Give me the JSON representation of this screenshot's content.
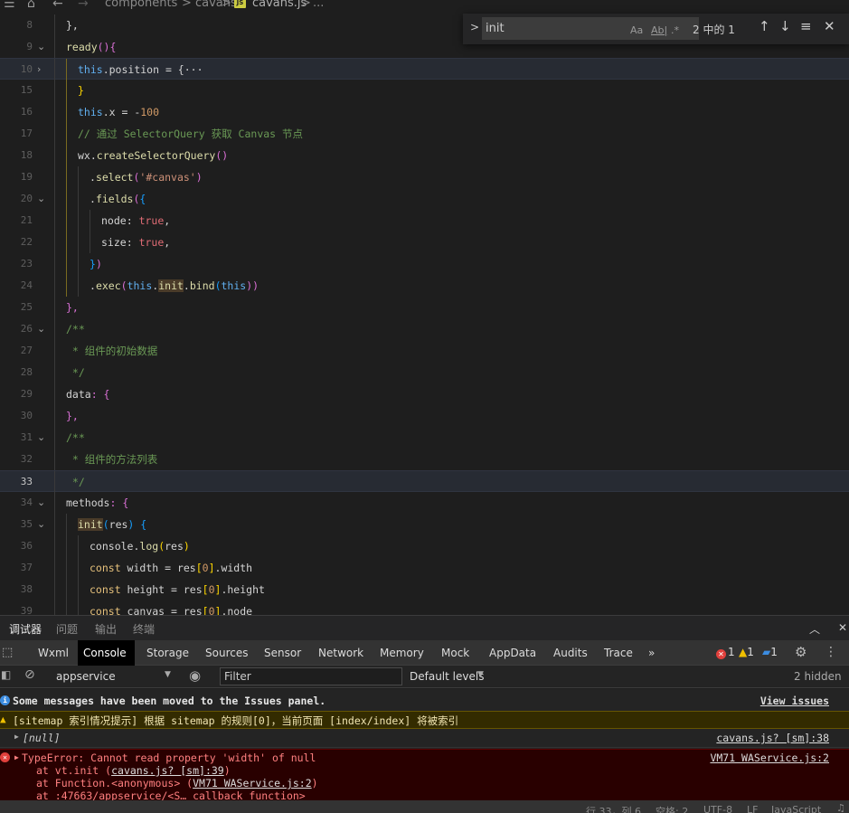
{
  "breadcrumb": {
    "parts": [
      "components",
      "cavans",
      "cavans.js",
      "..."
    ],
    "sep": ">",
    "js_badge": "JS"
  },
  "find": {
    "value": "init",
    "opt_case": "Aa",
    "opt_word": "Ab|",
    "opt_regex": ".*",
    "count": "2 中的 1",
    "prev": "↑",
    "next": "↓",
    "selection": "≡",
    "close": "✕",
    "toggle": ">"
  },
  "lines": [
    "8",
    "9",
    "10",
    "15",
    "16",
    "17",
    "18",
    "19",
    "20",
    "21",
    "22",
    "23",
    "24",
    "25",
    "26",
    "27",
    "28",
    "29",
    "30",
    "31",
    "32",
    "33",
    "34",
    "35",
    "36",
    "37",
    "38",
    "39"
  ],
  "code": {
    "l8": "},",
    "l9a": "ready",
    "l9b": "(){",
    "l10a": "this",
    "l10b": ".position = {",
    "l10c": "···",
    "l15": "}",
    "l16a": "this",
    "l16b": ".x = -",
    "l16c": "100",
    "l17": "// 通过 SelectorQuery 获取 Canvas 节点",
    "l18a": "wx",
    "l18b": ".",
    "l18c": "createSelectorQuery",
    "l18d": "()",
    "l19a": ".",
    "l19b": "select",
    "l19c": "(",
    "l19d": "'#canvas'",
    "l19e": ")",
    "l20a": ".",
    "l20b": "fields",
    "l20c": "(",
    "l20d": "{",
    "l21a": "node",
    "l21b": ": ",
    "l21c": "true",
    "l21d": ",",
    "l22a": "size",
    "l22b": ": ",
    "l22c": "true",
    "l22d": ",",
    "l23a": "}",
    "l23b": ")",
    "l24a": ".",
    "l24b": "exec",
    "l24c": "(",
    "l24d": "this",
    "l24e": ".",
    "l24f": "init",
    "l24g": ".",
    "l24h": "bind",
    "l24i": "(",
    "l24j": "this",
    "l24k": "))",
    "l25": "},",
    "l26": "/**",
    "l27": " * 组件的初始数据",
    "l28": " */",
    "l29a": "data",
    "l29b": ": {",
    "l30": "},",
    "l31": "/**",
    "l32": " * 组件的方法列表",
    "l33": " */",
    "l34a": "methods",
    "l34b": ": {",
    "l35a": "init",
    "l35b": "(",
    "l35c": "res",
    "l35d": ") {",
    "l36a": "console",
    "l36b": ".",
    "l36c": "log",
    "l36d": "(",
    "l36e": "res",
    "l36f": ")",
    "l37a": "const ",
    "l37b": "width",
    "l37c": " = res",
    "l37d": "[",
    "l37e": "0",
    "l37f": "]",
    "l37g": ".width",
    "l38a": "const ",
    "l38b": "height",
    "l38c": " = res",
    "l38d": "[",
    "l38e": "0",
    "l38f": "]",
    "l38g": ".height",
    "l39a": "const ",
    "l39b": "canvas",
    "l39c": " = res",
    "l39d": "[",
    "l39e": "0",
    "l39f": "]",
    "l39g": ".node"
  },
  "panel_tabs": [
    "调试器",
    "问题",
    "输出",
    "终端"
  ],
  "panel_icons": {
    "collapse": "︿",
    "close": "✕"
  },
  "devtools_tabs": [
    "Wxml",
    "Console",
    "Storage",
    "Sources",
    "Sensor",
    "Network",
    "Memory",
    "Mock",
    "AppData",
    "Audits",
    "Trace",
    "»"
  ],
  "badges": {
    "errors": "1",
    "warnings": "1",
    "info": "1"
  },
  "console_toolbar": {
    "context": "appservice",
    "filter_placeholder": "Filter",
    "levels": "Default levels",
    "hidden": "2 hidden"
  },
  "messages": {
    "info": "Some messages have been moved to the Issues panel.",
    "info_link": "View issues",
    "warn": "[sitemap 索引情况提示] 根据 sitemap 的规则[0]，当前页面 [index/index] 将被索引",
    "null_text": "[null]",
    "null_link": "cavans.js? [sm]:38",
    "err_title": "TypeError: Cannot read property 'width' of null",
    "err_link": "VM71 WAService.js:2",
    "stack1_pre": "at vt.init (",
    "stack1_link": "cavans.js? [sm]:39",
    "stack1_post": ")",
    "stack2_pre": "at Function.<anonymous> (",
    "stack2_link": "VM71 WAService.js:2",
    "stack2_post": ")",
    "stack3": "at :47663/appservice/<S… callback function>"
  },
  "statusbar": {
    "position": "行 33，列 6",
    "spaces": "空格: 2",
    "encoding": "UTF-8",
    "eol": "LF",
    "lang": "JavaScript"
  }
}
